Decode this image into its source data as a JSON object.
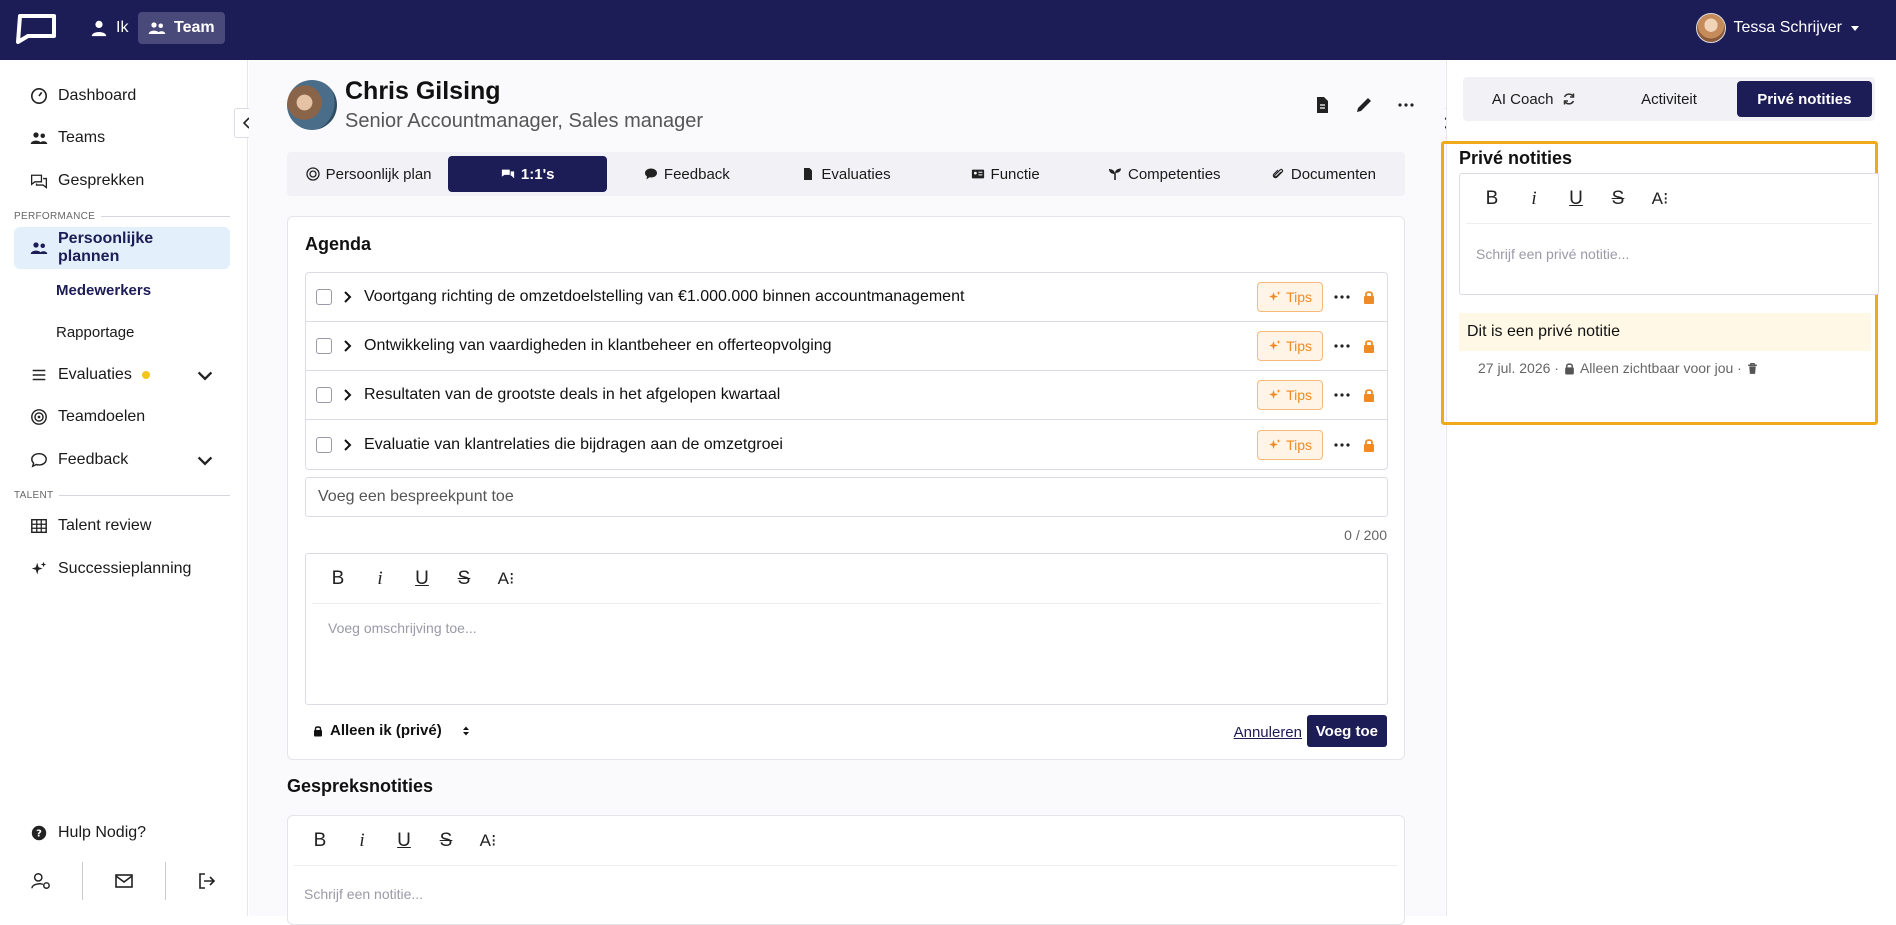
{
  "topbar": {
    "nav_me": "Ik",
    "nav_team": "Team",
    "user_name": "Tessa Schrijver"
  },
  "sidebar": {
    "items": [
      {
        "label": "Dashboard"
      },
      {
        "label": "Teams"
      },
      {
        "label": "Gesprekken"
      }
    ],
    "section_performance": "PERFORMANCE",
    "plans_label": "Persoonlijke plannen",
    "plans_sub": [
      {
        "label": "Medewerkers"
      },
      {
        "label": "Rapportage"
      }
    ],
    "evaluaties": "Evaluaties",
    "teamdoelen": "Teamdoelen",
    "feedback": "Feedback",
    "section_talent": "TALENT",
    "talent_review": "Talent review",
    "succession": "Successieplanning",
    "help": "Hulp Nodig?"
  },
  "person": {
    "name": "Chris Gilsing",
    "role": "Senior Accountmanager, Sales manager"
  },
  "tabs": [
    {
      "label": "Persoonlijk plan"
    },
    {
      "label": "1:1's"
    },
    {
      "label": "Feedback"
    },
    {
      "label": "Evaluaties"
    },
    {
      "label": "Functie"
    },
    {
      "label": "Competenties"
    },
    {
      "label": "Documenten"
    }
  ],
  "agenda": {
    "title": "Agenda",
    "tips_label": "Tips",
    "items": [
      {
        "text": "Voortgang richting de omzetdoelstelling van €1.000.000 binnen accountmanagement"
      },
      {
        "text": "Ontwikkeling van vaardigheden in klantbeheer en offerteopvolging"
      },
      {
        "text": "Resultaten van de grootste deals in het afgelopen kwartaal"
      },
      {
        "text": "Evaluatie van klantrelaties die bijdragen aan de omzetgroei"
      }
    ],
    "add_point_placeholder": "Voeg een bespreekpunt toe",
    "counter": "0 / 200",
    "description_placeholder": "Voeg omschrijving toe...",
    "privacy": "Alleen ik (privé)",
    "cancel": "Annuleren",
    "add": "Voeg toe"
  },
  "toolbar": {
    "bold": "B",
    "italic": "i",
    "underline": "U",
    "strike": "S",
    "size": "A⁝"
  },
  "notes": {
    "title": "Gespreksnotities",
    "placeholder": "Schrijf een notitie..."
  },
  "right": {
    "tabs": [
      {
        "label": "AI Coach"
      },
      {
        "label": "Activiteit"
      },
      {
        "label": "Privé notities"
      }
    ],
    "title": "Privé notities",
    "placeholder": "Schrijf een privé notitie...",
    "note_text": "Dit is een privé notitie",
    "note_date": "27 jul. 2026 ·",
    "note_visibility": "Alleen zichtbaar voor jou ·"
  },
  "colors": {
    "navy": "#1c1c57",
    "accent_orange": "#f08a24",
    "highlight": "#f0a91a"
  }
}
